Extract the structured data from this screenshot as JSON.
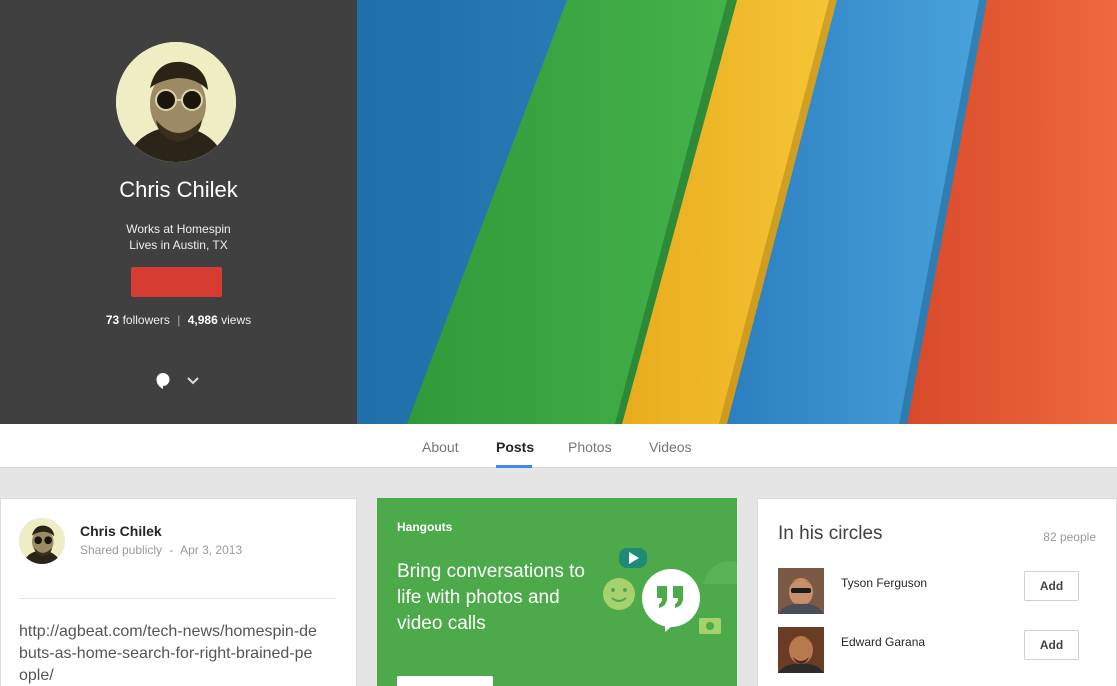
{
  "profile": {
    "name": "Chris Chilek",
    "work": "Works at Homespin",
    "location": "Lives in Austin, TX",
    "followers_count": "73",
    "followers_label": "followers",
    "separator": "|",
    "views_count": "4,986",
    "views_label": "views",
    "icons": [
      "hangouts-icon",
      "chevron-down-icon"
    ]
  },
  "tabs": [
    {
      "label": "About",
      "active": false
    },
    {
      "label": "Posts",
      "active": true
    },
    {
      "label": "Photos",
      "active": false
    },
    {
      "label": "Videos",
      "active": false
    }
  ],
  "post": {
    "author": "Chris Chilek",
    "visibility": "Shared publicly",
    "meta_separator": "-",
    "date": "Apr 3, 2013",
    "text": "http://agbeat.com/tech-news/homespin-debuts-as-home-search-for-right-brained-people/"
  },
  "hangouts": {
    "label": "Hangouts",
    "headline": "Bring conversations to life with photos and video calls",
    "icons": [
      "play-icon",
      "smiley-icon",
      "quote-bubble-icon",
      "camera-icon"
    ]
  },
  "circles": {
    "title": "In his circles",
    "count": "82 people",
    "people": [
      {
        "name": "Tyson Ferguson",
        "button": "Add"
      },
      {
        "name": "Edward Garana",
        "button": "Add"
      }
    ]
  },
  "colors": {
    "accent_red": "#d73c33",
    "tab_underline": "#4285f4",
    "hangouts_green": "#4caa4b",
    "profile_panel": "#404040"
  }
}
